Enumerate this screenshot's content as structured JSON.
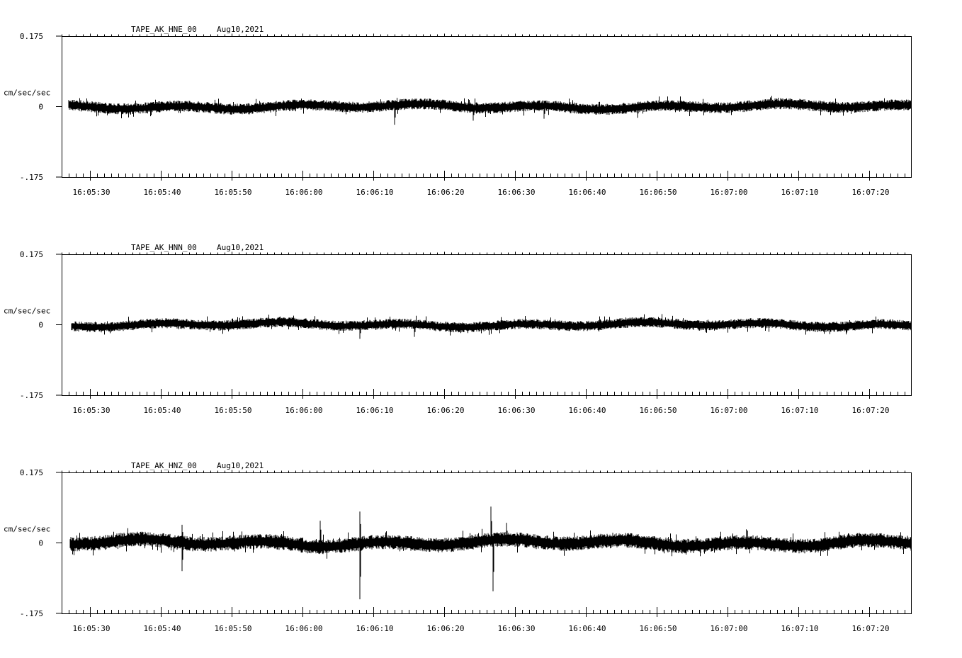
{
  "chart_data": [
    {
      "type": "line",
      "station": "TAPE_AK_HNE_00",
      "date": "Aug10,2021",
      "ylabel": "cm/sec/sec",
      "ylim": [
        -0.175,
        0.175
      ],
      "yticks": [
        "0.175",
        "0",
        "-.175"
      ],
      "xticks": [
        "16:05:30",
        "16:05:40",
        "16:05:50",
        "16:06:00",
        "16:06:10",
        "16:06:20",
        "16:06:30",
        "16:06:40",
        "16:06:50",
        "16:07:00",
        "16:07:10",
        "16:07:20"
      ],
      "x_range_seconds": [
        -4,
        56
      ],
      "signal_start_seconds": -1,
      "noise_amplitude": 0.012,
      "spikes": [
        {
          "t_seconds": 43.0,
          "value": -0.045
        },
        {
          "t_seconds": 54.1,
          "value": -0.035
        },
        {
          "t_seconds": 64.1,
          "value": -0.03
        },
        {
          "t_seconds": 77.3,
          "value": -0.028
        }
      ],
      "series": [
        {
          "values_note_only": true
        }
      ]
    },
    {
      "type": "line",
      "station": "TAPE_AK_HNN_00",
      "date": "Aug10,2021",
      "ylabel": "cm/sec/sec",
      "ylim": [
        -0.175,
        0.175
      ],
      "yticks": [
        "0.175",
        "0",
        "-.175"
      ],
      "xticks": [
        "16:05:30",
        "16:05:40",
        "16:05:50",
        "16:06:00",
        "16:06:10",
        "16:06:20",
        "16:06:30",
        "16:06:40",
        "16:06:50",
        "16:07:00",
        "16:07:10",
        "16:07:20"
      ],
      "signal_start_seconds": -0.6,
      "noise_amplitude": 0.011,
      "spikes": [
        {
          "t_seconds": 38.1,
          "value": -0.035
        },
        {
          "t_seconds": 45.8,
          "value": -0.03
        }
      ]
    },
    {
      "type": "line",
      "station": "TAPE_AK_HNZ_00",
      "date": "Aug10,2021",
      "ylabel": "cm/sec/sec",
      "ylim": [
        -0.175,
        0.175
      ],
      "yticks": [
        "0.175",
        "0",
        "-.175"
      ],
      "xticks": [
        "16:05:30",
        "16:05:40",
        "16:05:50",
        "16:06:00",
        "16:06:10",
        "16:06:20",
        "16:06:30",
        "16:06:40",
        "16:06:50",
        "16:07:00",
        "16:07:10",
        "16:07:20"
      ],
      "signal_start_seconds": -0.8,
      "noise_amplitude": 0.016,
      "spikes": [
        {
          "t_seconds": 13.0,
          "value": -0.07
        },
        {
          "t_seconds": 13.0,
          "value": 0.045
        },
        {
          "t_seconds": 32.5,
          "value": 0.055
        },
        {
          "t_seconds": 38.1,
          "value": -0.14
        },
        {
          "t_seconds": 38.1,
          "value": 0.078
        },
        {
          "t_seconds": 56.6,
          "value": 0.09
        },
        {
          "t_seconds": 56.9,
          "value": -0.12
        },
        {
          "t_seconds": 58.8,
          "value": 0.05
        }
      ]
    }
  ]
}
